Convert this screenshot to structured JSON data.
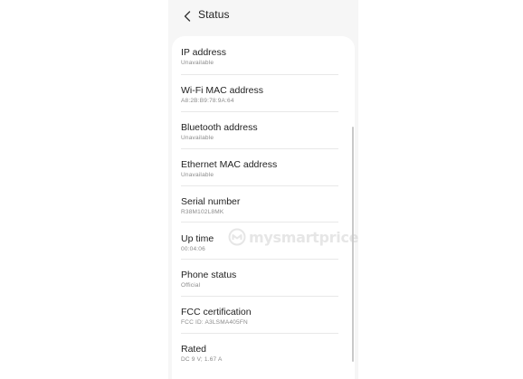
{
  "header": {
    "back_icon": "back-arrow-icon",
    "title": "Status"
  },
  "items": [
    {
      "title": "IP address",
      "value": "Unavailable"
    },
    {
      "title": "Wi-Fi MAC address",
      "value": "A8:2B:B9:78:9A:64"
    },
    {
      "title": "Bluetooth address",
      "value": "Unavailable"
    },
    {
      "title": "Ethernet MAC address",
      "value": "Unavailable"
    },
    {
      "title": "Serial number",
      "value": "R38M102L8MK"
    },
    {
      "title": "Up time",
      "value": "00:04:06"
    },
    {
      "title": "Phone status",
      "value": "Official"
    },
    {
      "title": "FCC certification",
      "value": "FCC ID: A3LSMA405FN"
    },
    {
      "title": "Rated",
      "value": "DC 9 V; 1.67 A"
    }
  ],
  "watermark": {
    "text": "mysmartprice",
    "icon": "mysmartprice-logo-icon"
  },
  "colors": {
    "background": "#f6f6f6",
    "card": "#ffffff",
    "title_text": "#1f1f1f",
    "sub_text": "#8a8a8a"
  }
}
